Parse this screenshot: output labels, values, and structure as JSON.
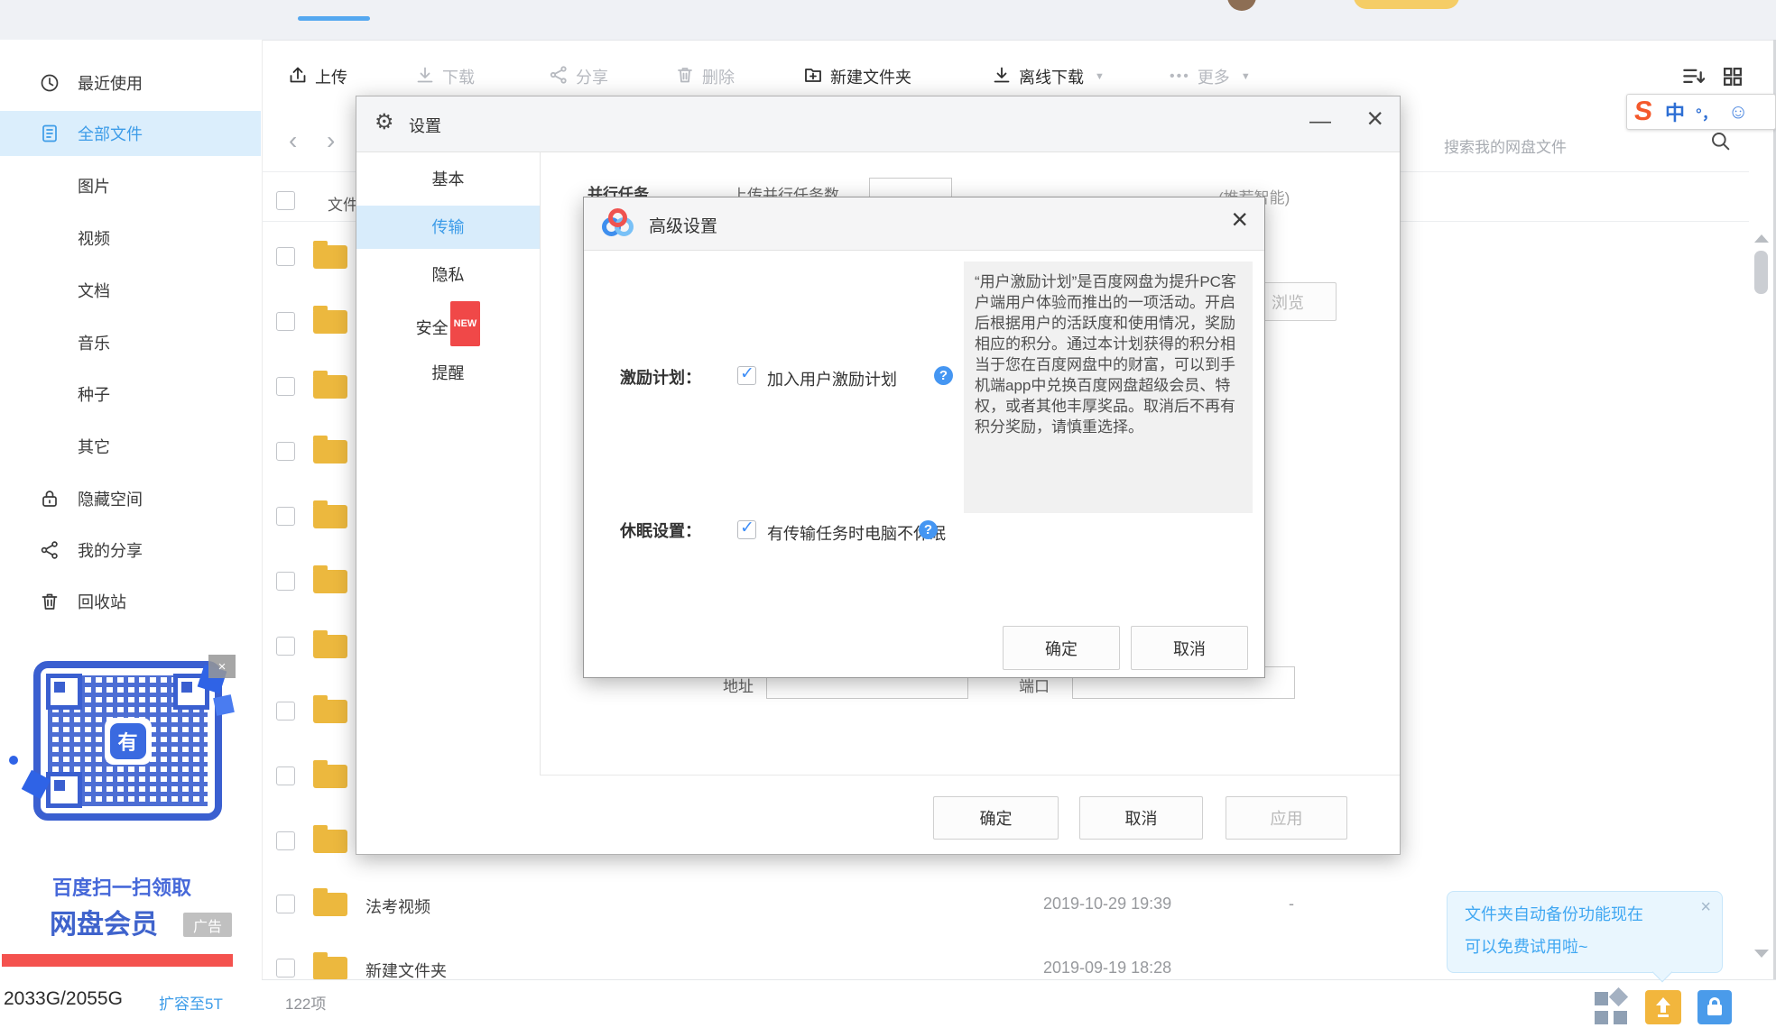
{
  "icons": {
    "gear": "⚙",
    "minimize": "—",
    "close": "×",
    "help": "?",
    "check": "✓",
    "caret": "▼",
    "more_dots": "•••",
    "nav_back": "‹",
    "nav_forward": "›"
  },
  "toolbar": {
    "items": [
      {
        "label": "上传",
        "enabled": true
      },
      {
        "label": "下载",
        "enabled": false
      },
      {
        "label": "分享",
        "enabled": false
      },
      {
        "label": "删除",
        "enabled": false
      },
      {
        "label": "新建文件夹",
        "enabled": true
      },
      {
        "label": "离线下载",
        "enabled": true,
        "has_caret": true
      },
      {
        "label": "更多",
        "enabled": false,
        "has_caret": true
      }
    ]
  },
  "search": {
    "placeholder": "搜索我的网盘文件"
  },
  "ime": {
    "s": "S",
    "mode": "中",
    "punct": "°，",
    "smiley": "☺"
  },
  "sidebar": {
    "items": [
      {
        "label": "最近使用"
      },
      {
        "label": "全部文件",
        "active": true
      },
      {
        "label": "图片"
      },
      {
        "label": "视频"
      },
      {
        "label": "文档"
      },
      {
        "label": "音乐"
      },
      {
        "label": "种子"
      },
      {
        "label": "其它"
      },
      {
        "label": "隐藏空间"
      },
      {
        "label": "我的分享"
      },
      {
        "label": "回收站"
      }
    ]
  },
  "ad": {
    "line1": "百度扫一扫领取",
    "line2": "网盘会员",
    "badge": "广告",
    "qr_logo": "有"
  },
  "storage": {
    "usage": "2033G/2055G",
    "upgrade": "扩容至5T"
  },
  "files": {
    "header": "文件",
    "rows": [
      {
        "name": "法考视频",
        "date": "2019-10-29 19:39",
        "size": "-"
      },
      {
        "name": "新建文件夹",
        "date": "2019-09-19 18:28",
        "size": ""
      }
    ],
    "count": "122项"
  },
  "settings": {
    "title": "设置",
    "tabs": [
      {
        "label": "基本"
      },
      {
        "label": "传输",
        "active": true
      },
      {
        "label": "隐私"
      },
      {
        "label": "安全",
        "badge": "NEW"
      },
      {
        "label": "提醒"
      }
    ],
    "fragments": {
      "parallel": "并行任务",
      "upload_parallel": "上传并行任务数",
      "recommend_smart": "(推荐智能)",
      "browse": "浏览",
      "address": "地址",
      "port": "端口"
    },
    "buttons": {
      "ok": "确定",
      "cancel": "取消",
      "apply": "应用"
    }
  },
  "advanced": {
    "title": "高级设置",
    "incentive_label": "激励计划：",
    "incentive_option": "加入用户激励计划",
    "sleep_label": "休眠设置：",
    "sleep_option": "有传输任务时电脑不休眠",
    "tooltip": "“用户激励计划”是百度网盘为提升PC客户端用户体验而推出的一项活动。开启后根据用户的活跃度和使用情况，奖励相应的积分。通过本计划获得的积分相当于您在百度网盘中的财富，可以到手机端app中兑换百度网盘超级会员、特权，或者其他丰厚奖品。取消后不再有积分奖励，请慎重选择。",
    "buttons": {
      "ok": "确定",
      "cancel": "取消"
    }
  },
  "notification": {
    "line1": "文件夹自动备份功能现在",
    "line2": "可以免费试用啦~"
  }
}
